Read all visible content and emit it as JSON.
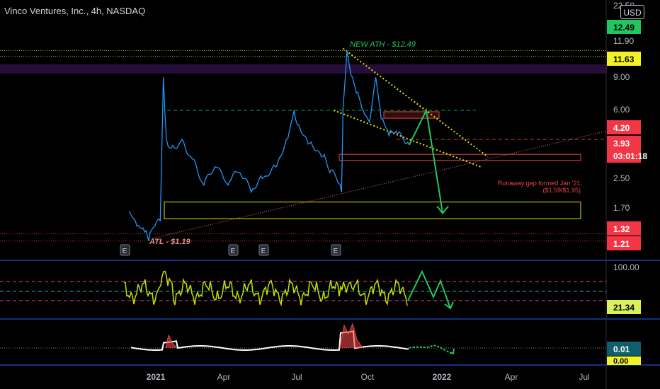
{
  "header": {
    "title": "Vinco Ventures, Inc., 4h, NASDAQ",
    "currency": "USD"
  },
  "colors": {
    "price": "#2196f3",
    "rsi": "#c6e000",
    "green": "#22c55e",
    "red": "#ef4444",
    "yellow": "#e6e600",
    "purple_band": "#2a1040"
  },
  "chart_data": {
    "type": "line",
    "price_axis": {
      "scale": "log",
      "ticks": [
        "22.50",
        "12.49",
        "11.90",
        "11.63",
        "9.00",
        "6.00",
        "4.20",
        "3.93",
        "2.50",
        "1.70",
        "1.32",
        "1.21"
      ],
      "badges": [
        {
          "label": "12.49",
          "kind": "new-ath"
        },
        {
          "label": "11.63",
          "kind": "yellow"
        },
        {
          "label": "4.20",
          "kind": "red"
        },
        {
          "label": "3.93",
          "kind": "last-price"
        },
        {
          "label": "03:01:18",
          "kind": "countdown"
        },
        {
          "label": "1.32",
          "kind": "red"
        },
        {
          "label": "1.21",
          "kind": "red"
        }
      ]
    },
    "time_axis": {
      "labels": [
        "2021",
        "Apr",
        "Jul",
        "Oct",
        "2022",
        "Apr",
        "Jul"
      ]
    },
    "series": [
      {
        "name": "Price",
        "x": [
          "2020-11-25",
          "2020-12-05",
          "2020-12-15",
          "2020-12-20",
          "2020-12-28",
          "2021-01-04",
          "2021-01-08",
          "2021-01-12",
          "2021-01-20",
          "2021-02-01",
          "2021-02-15",
          "2021-03-01",
          "2021-03-15",
          "2021-04-01",
          "2021-04-15",
          "2021-05-01",
          "2021-05-15",
          "2021-06-01",
          "2021-06-15",
          "2021-06-25",
          "2021-07-01",
          "2021-07-15",
          "2021-08-01",
          "2021-08-10",
          "2021-08-20",
          "2021-08-25",
          "2021-08-27",
          "2021-09-01",
          "2021-09-08",
          "2021-09-15",
          "2021-09-22",
          "2021-09-30",
          "2021-10-08",
          "2021-10-15",
          "2021-10-25",
          "2021-11-05",
          "2021-11-15",
          "2021-11-20"
        ],
        "y": [
          1.75,
          1.45,
          1.35,
          1.21,
          1.45,
          1.55,
          9.0,
          4.2,
          3.9,
          4.2,
          3.3,
          2.4,
          3.0,
          2.4,
          2.8,
          2.2,
          2.6,
          3.0,
          4.2,
          6.0,
          5.0,
          4.0,
          3.4,
          2.8,
          2.5,
          2.2,
          6.3,
          12.49,
          9.0,
          7.5,
          6.0,
          5.2,
          9.0,
          5.4,
          4.4,
          4.5,
          4.0,
          3.93
        ]
      },
      {
        "name": "Projection",
        "x": [
          "2021-11-20",
          "2021-12-12",
          "2022-01-02"
        ],
        "y": [
          3.93,
          6.0,
          1.7
        ]
      }
    ],
    "levels": [
      {
        "value": 12.49,
        "style": "dotted-yellow"
      },
      {
        "value": 11.63,
        "style": "dotted-yellow"
      },
      {
        "value": 6.0,
        "style": "dashed-green"
      },
      {
        "value": 4.2,
        "style": "dashed-red"
      },
      {
        "value": 1.32,
        "style": "dotted-red"
      },
      {
        "value": 1.21,
        "style": "dotted-red"
      }
    ],
    "annotations": {
      "ath": "NEW ATH - $12.49",
      "atl": "ATL - $1.19",
      "gap_line1": "Runaway gap formed Jan '21.",
      "gap_line2": "($1.59/$1.95)",
      "earnings": [
        "E",
        "E",
        "E",
        "E"
      ]
    },
    "rsi": {
      "axis_labels": [
        "100.00",
        "21.34",
        "0.00"
      ],
      "last": "21.34"
    },
    "oscillator": {
      "axis_labels": [
        "0.01",
        "0.00"
      ],
      "last": "0.01"
    }
  }
}
